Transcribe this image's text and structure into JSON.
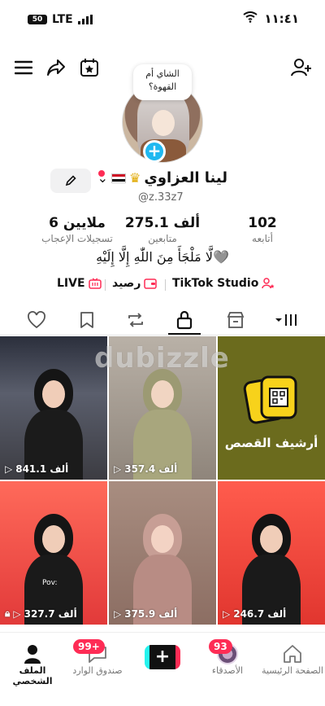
{
  "status_bar": {
    "battery": "50",
    "network": "LTE",
    "time": "١١:٤١"
  },
  "profile": {
    "note": [
      "الشاي أم",
      "القهوة؟"
    ],
    "name": "لينا العزاوي",
    "handle": "@z.33z7",
    "bio": "لَّا مَلْجَأَ مِنَ اللّٰهِ إِلَّا إِلَيْهِ🩶"
  },
  "stats": [
    {
      "value": "102",
      "label": "أتابعه"
    },
    {
      "value": "275.1 ألف",
      "label": "متابعين"
    },
    {
      "value": "6 ملايين",
      "label": "تسجيلات الإعجاب"
    }
  ],
  "links": {
    "studio": "TikTok Studio",
    "balance": "رصيد",
    "live": "LIVE"
  },
  "watermark": "dubizzle",
  "videos": [
    {
      "views": "841.1 ألف"
    },
    {
      "views": "357.4 ألف"
    },
    {
      "archive_label": "أرشيف القصص"
    },
    {
      "views": "327.7 ألف",
      "caption": "Pov:"
    },
    {
      "views": "375.9 ألف"
    },
    {
      "views": "246.7 ألف"
    }
  ],
  "bottom_nav": {
    "home": "الصفحة الرئيسية",
    "friends": "الأصدقاء",
    "friends_badge": "93",
    "inbox": "صندوق الوارد",
    "inbox_badge": "99+",
    "profile": "الملف الشخصي"
  },
  "colors": {
    "accent": "#fe2c55",
    "plus": "#20b8f0",
    "tab_indicator": "#111111"
  }
}
